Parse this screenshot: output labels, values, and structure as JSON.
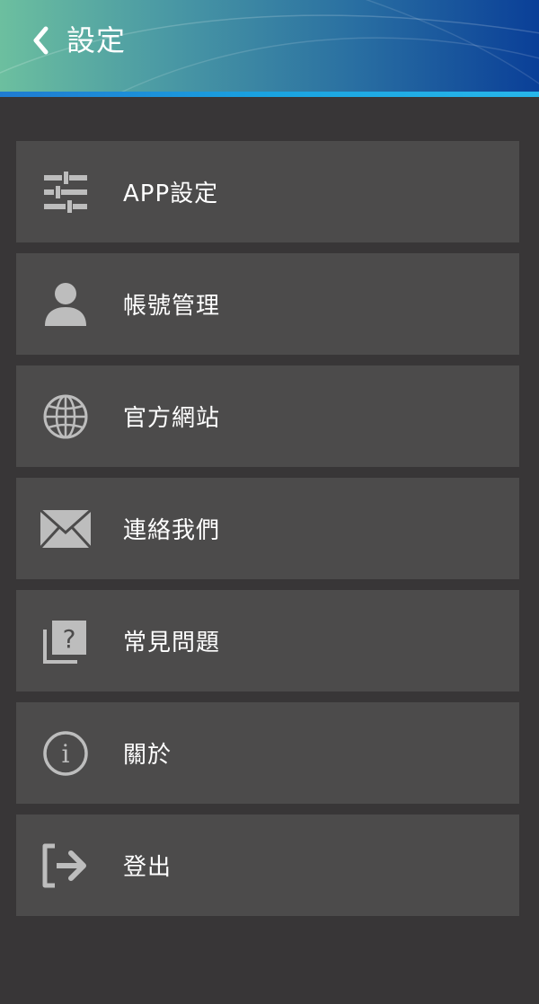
{
  "header": {
    "title": "設定",
    "back_icon": "chevron-left-icon",
    "gradient": [
      "#6cbf9f",
      "#0a3f98"
    ]
  },
  "menu": {
    "items": [
      {
        "label": "APP設定",
        "icon": "sliders-icon"
      },
      {
        "label": "帳號管理",
        "icon": "user-icon"
      },
      {
        "label": "官方網站",
        "icon": "globe-icon"
      },
      {
        "label": "連絡我們",
        "icon": "envelope-icon"
      },
      {
        "label": "常見問題",
        "icon": "question-icon"
      },
      {
        "label": "關於",
        "icon": "info-icon"
      },
      {
        "label": "登出",
        "icon": "logout-icon"
      }
    ]
  },
  "colors": {
    "background": "#383637",
    "item_background": "#4c4b4b",
    "icon": "#bdbdbd",
    "text": "#ffffff"
  }
}
